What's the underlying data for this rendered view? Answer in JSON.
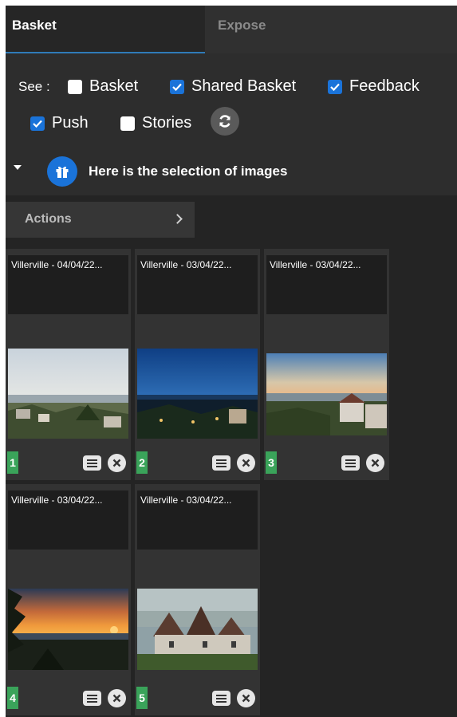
{
  "tabs": [
    {
      "label": "Basket",
      "active": true
    },
    {
      "label": "Expose",
      "active": false
    }
  ],
  "filters": {
    "see_label": "See :",
    "options": [
      {
        "label": "Basket",
        "checked": false
      },
      {
        "label": "Shared Basket",
        "checked": true
      },
      {
        "label": "Feedback",
        "checked": true
      },
      {
        "label": "Push",
        "checked": true
      },
      {
        "label": "Stories",
        "checked": false
      }
    ],
    "refresh_icon": "refresh-icon"
  },
  "selection": {
    "text": "Here is the selection of images",
    "icon": "gift-icon"
  },
  "actions": {
    "label": "Actions",
    "icon": "chevron-right-icon"
  },
  "images": [
    {
      "number": "1",
      "title": "Villerville - 04/04/22..."
    },
    {
      "number": "2",
      "title": "Villerville - 03/04/22..."
    },
    {
      "number": "3",
      "title": "Villerville - 03/04/22..."
    },
    {
      "number": "4",
      "title": "Villerville - 03/04/22..."
    },
    {
      "number": "5",
      "title": "Villerville - 03/04/22..."
    }
  ],
  "colors": {
    "accent_blue": "#1a73d9",
    "badge_green": "#3aa35a",
    "panel_bg": "#2a2a2a"
  }
}
